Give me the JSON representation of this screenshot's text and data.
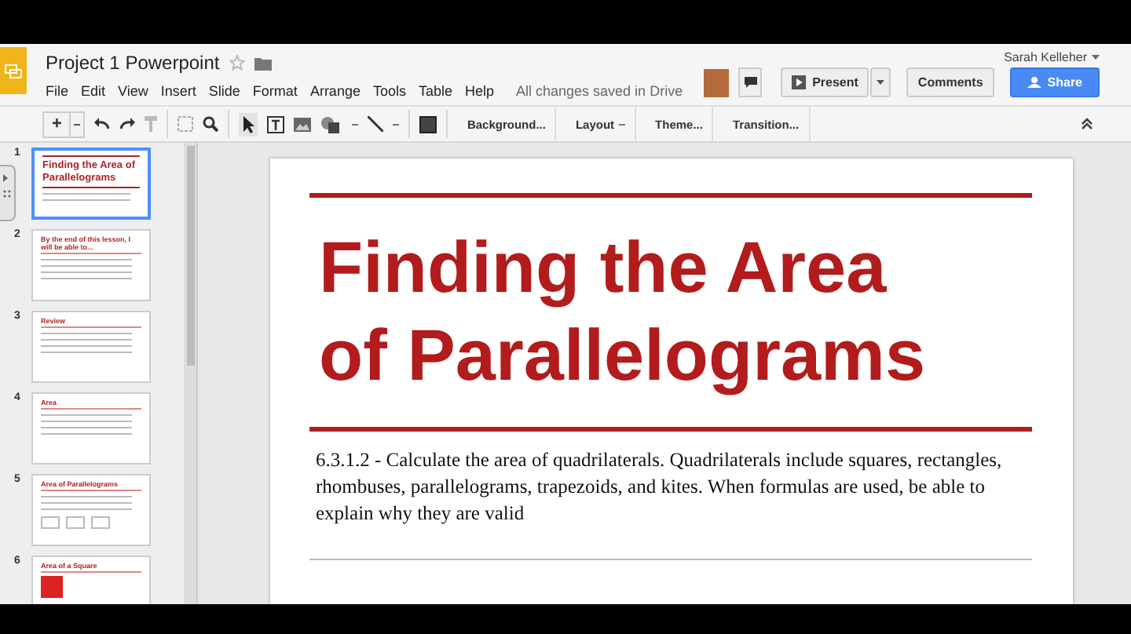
{
  "document": {
    "title": "Project 1 Powerpoint"
  },
  "menu": [
    "File",
    "Edit",
    "View",
    "Insert",
    "Slide",
    "Format",
    "Arrange",
    "Tools",
    "Table",
    "Help"
  ],
  "save_status": "All changes saved in Drive",
  "user": "Sarah Kelleher",
  "buttons": {
    "present": "Present",
    "comments": "Comments",
    "share": "Share"
  },
  "toolbar": {
    "add": "+",
    "background": "Background...",
    "layout": "Layout",
    "theme": "Theme...",
    "transition": "Transition..."
  },
  "slides": [
    {
      "number": "1",
      "kind": "title",
      "title": "Finding the Area of Parallelograms",
      "selected": true
    },
    {
      "number": "2",
      "kind": "list",
      "title": "By the end of this lesson, I will be able to...",
      "selected": false
    },
    {
      "number": "3",
      "kind": "list",
      "title": "Review",
      "selected": false
    },
    {
      "number": "4",
      "kind": "list",
      "title": "Area",
      "selected": false
    },
    {
      "number": "5",
      "kind": "shapes",
      "title": "Area of Parallelograms",
      "selected": false
    },
    {
      "number": "6",
      "kind": "image",
      "title": "Area of a Square",
      "selected": false
    }
  ],
  "current_slide": {
    "title": "Finding the Area of Parallelograms",
    "body": "6.3.1.2 - Calculate the area of quadrilaterals. Quadrilaterals include squares, rectangles, rhombuses, parallelograms, trapezoids, and kites. When formulas are used, be able to explain why they are valid"
  }
}
